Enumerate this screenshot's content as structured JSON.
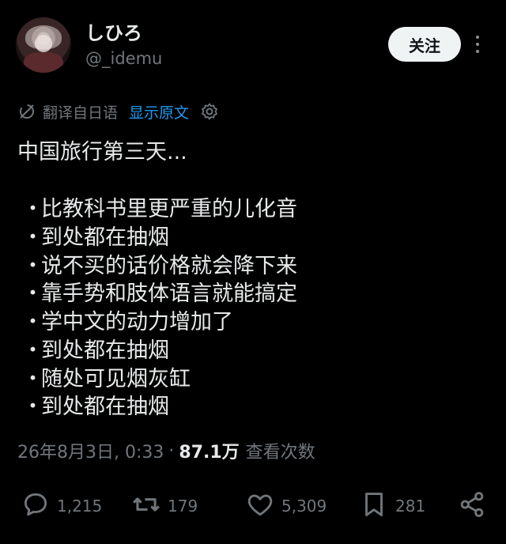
{
  "user": {
    "display_name": "しひろ",
    "handle": "@_idemu"
  },
  "follow_button_label": "关注",
  "translation": {
    "label": "翻译自日语",
    "show_original": "显示原文"
  },
  "tweet": {
    "title": "中国旅行第三天...",
    "bullet": "・",
    "items": [
      "比教科书里更严重的儿化音",
      "到处都在抽烟",
      "说不买的话价格就会降下来",
      "靠手势和肢体语言就能搞定",
      "学中文的动力增加了",
      "到处都在抽烟",
      "随处可见烟灰缸",
      "到处都在抽烟"
    ]
  },
  "meta": {
    "timestamp": "26年8月3日, 0:33",
    "separator": "·",
    "views_count": "87.1万",
    "views_label": "查看次数"
  },
  "actions": {
    "replies": "1,215",
    "retweets": "179",
    "likes": "5,309",
    "bookmarks": "281"
  },
  "colors": {
    "background": "#000000",
    "text": "#e7e9ea",
    "muted": "#71767b",
    "link": "#1d9bf0",
    "button_bg": "#eff3f4"
  },
  "icons": [
    "avatar",
    "more-icon",
    "translate-icon",
    "settings-icon",
    "reply-icon",
    "retweet-icon",
    "like-icon",
    "bookmark-icon",
    "share-icon"
  ]
}
